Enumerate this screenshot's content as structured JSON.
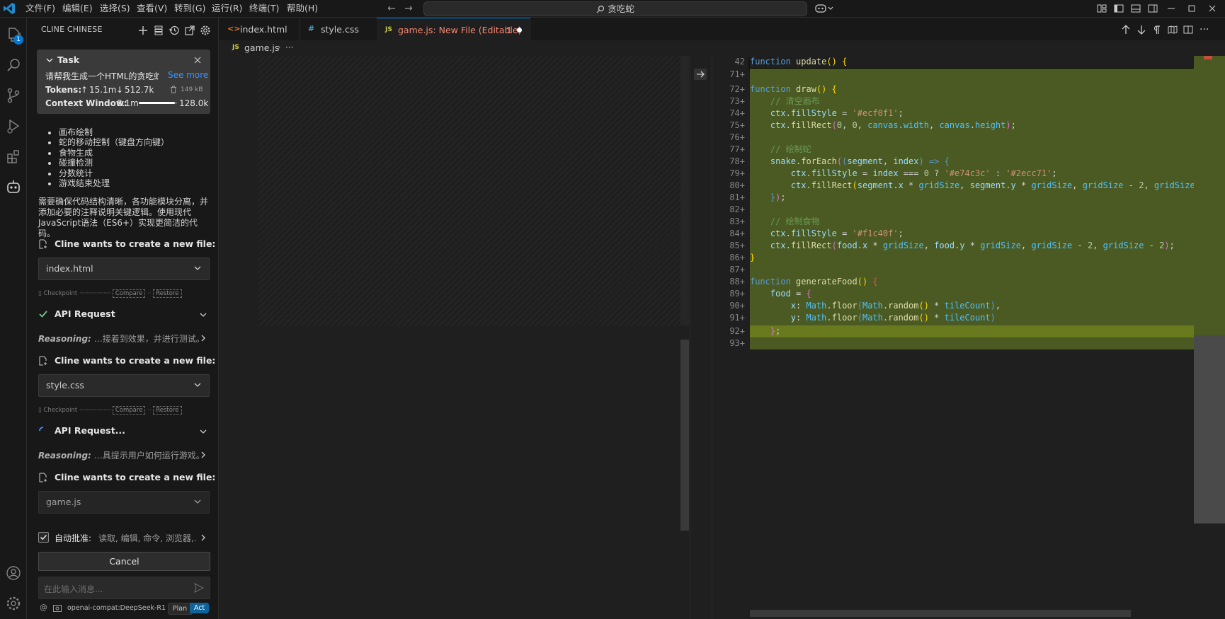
{
  "menu": {
    "file": "文件(F)",
    "edit": "编辑(E)",
    "selection": "选择(S)",
    "view": "查看(V)",
    "goto": "转到(G)",
    "run": "运行(R)",
    "terminal": "终端(T)",
    "help": "帮助(H)"
  },
  "search": {
    "text": "贪吃蛇"
  },
  "activity": {
    "badge": "1"
  },
  "sidebar": {
    "title": "CLINE CHINESE",
    "task": {
      "header": "Task",
      "text": "请帮我生成一个HTML的贪吃蛇",
      "see_more": "See more",
      "tokens_label": "Tokens:",
      "tokens_up": "15.1m",
      "tokens_down": "512.7k",
      "size": "149 kB",
      "context_label": "Context Window:",
      "context_used": "8.1m",
      "context_max": "128.0k",
      "context_fill": 0.95
    },
    "features": [
      "画布绘制",
      "蛇的移动控制（键盘方向键）",
      "食物生成",
      "碰撞检测",
      "分数统计",
      "游戏结束处理"
    ],
    "paragraph_lines": [
      "需要确保代码结构清晰，各功能模块分离，并",
      "添加必要的注释说明关键逻辑。使用现代",
      "JavaScript语法（ES6+）实现更简洁的代码。"
    ],
    "create_file_label": "Cline wants to create a new file:",
    "files": [
      "index.html",
      "style.css",
      "game.js"
    ],
    "checkpoint": {
      "label": "Checkpoint",
      "compare": "Compare",
      "restore": "Restore"
    },
    "api_request_done": "API Request",
    "api_request_pending": "API Request...",
    "reasoning_label": "Reasoning:",
    "reasoning_1": "…接着到效果，并进行测试。",
    "reasoning_2": "…具提示用户如何运行游戏。",
    "auto_approve_label": "自动批准:",
    "auto_approve_value": "读取, 编辑, 命令, 浏览器,…",
    "cancel": "Cancel",
    "input_placeholder": "在此输入消息...",
    "model": "openai-compat:DeepSeek-R1",
    "plan": "Plan",
    "act": "Act"
  },
  "tabs": [
    {
      "label": "index.html",
      "icon": "<>",
      "icon_color": "#e37933"
    },
    {
      "label": "style.css",
      "icon": "#",
      "icon_color": "#519aba"
    },
    {
      "label": "game.js: New File (Editable)",
      "badge": "1",
      "icon": "JS",
      "icon_color": "#cbcb41"
    }
  ],
  "breadcrumb": {
    "file": "game.js",
    "tail": "···"
  },
  "editor": {
    "line_numbers": [
      "42",
      "71+",
      "72+",
      "73+",
      "74+",
      "75+",
      "76+",
      "77+",
      "78+",
      "79+",
      "80+",
      "81+",
      "82+",
      "83+",
      "84+",
      "85+",
      "86+",
      "87+",
      "88+",
      "89+",
      "90+",
      "91+",
      "92+",
      "93+"
    ]
  },
  "colors": {
    "accent": "#0078d4",
    "diff_added": "#4b5a22",
    "diff_current": "#697a1e"
  }
}
